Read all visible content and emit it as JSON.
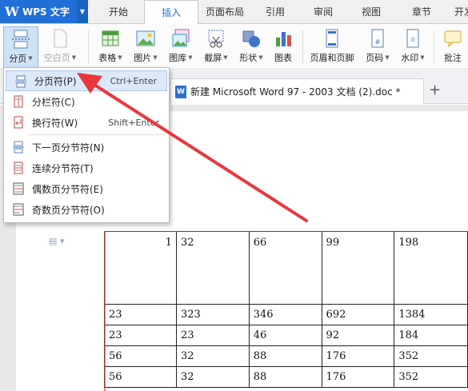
{
  "app": {
    "title": "WPS 文字",
    "logo": "W"
  },
  "tabs": [
    "开始",
    "插入",
    "页面布局",
    "引用",
    "审阅",
    "视图",
    "章节",
    "开发"
  ],
  "active_tab": "插入",
  "ribbon": {
    "page_break": "分页",
    "blank_page": "空白页",
    "table": "表格",
    "picture": "图片",
    "gallery": "图库",
    "screenshot": "截屏",
    "shape": "形状",
    "chart": "图表",
    "header_footer": "页眉和页脚",
    "page_number": "页码",
    "watermark": "水印",
    "comment": "批注"
  },
  "document_tab": "新建 Microsoft Word 97 - 2003 文档 (2).doc *",
  "new_tab_symbol": "+",
  "menu": {
    "items": [
      {
        "label": "分页符(P)",
        "shortcut": "Ctrl+Enter",
        "icon": "page-break-icon"
      },
      {
        "label": "分栏符(C)",
        "shortcut": "",
        "icon": "column-break-icon"
      },
      {
        "label": "换行符(W)",
        "shortcut": "Shift+Enter",
        "icon": "line-break-icon"
      },
      {
        "label": "下一页分节符(N)",
        "shortcut": "",
        "icon": "next-page-section-icon"
      },
      {
        "label": "连续分节符(T)",
        "shortcut": "",
        "icon": "continuous-section-icon"
      },
      {
        "label": "偶数页分节符(E)",
        "shortcut": "",
        "icon": "even-page-section-icon"
      },
      {
        "label": "奇数页分节符(O)",
        "shortcut": "",
        "icon": "odd-page-section-icon"
      }
    ]
  },
  "table": {
    "rows": [
      [
        "1",
        "32",
        "66",
        "99",
        "198"
      ],
      [
        "23",
        "323",
        "346",
        "692",
        "1384"
      ],
      [
        "23",
        "23",
        "46",
        "92",
        "184"
      ],
      [
        "56",
        "32",
        "88",
        "176",
        "352"
      ],
      [
        "56",
        "32",
        "88",
        "176",
        "352"
      ]
    ]
  },
  "colors": {
    "accent": "#1f6fd6",
    "annotation_arrow": "#e8383d",
    "menu_highlight": "#dbe9f9"
  }
}
